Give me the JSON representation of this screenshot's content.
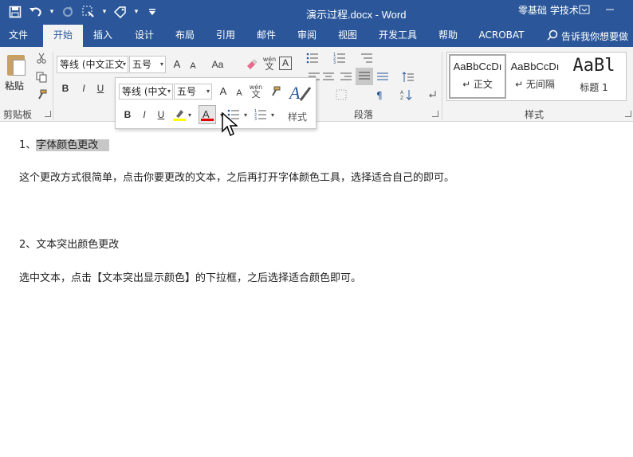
{
  "window": {
    "title": "演示过程.docx  -  Word",
    "user": "零基础 学技术",
    "controls": {
      "restore": "⧉",
      "minimize": "—"
    }
  },
  "qat": {
    "save_icon": "save-icon",
    "undo_icon": "undo-icon",
    "redo_icon": "redo-icon",
    "more": "▾"
  },
  "tabs": [
    {
      "label": "文件"
    },
    {
      "label": "开始",
      "active": true
    },
    {
      "label": "插入"
    },
    {
      "label": "设计"
    },
    {
      "label": "布局"
    },
    {
      "label": "引用"
    },
    {
      "label": "邮件"
    },
    {
      "label": "审阅"
    },
    {
      "label": "视图"
    },
    {
      "label": "开发工具"
    },
    {
      "label": "帮助"
    },
    {
      "label": "ACROBAT"
    }
  ],
  "tell_me": {
    "placeholder": "告诉我你想要做"
  },
  "ribbon": {
    "clipboard": {
      "paste_label": "粘贴",
      "group_label": "剪贴板"
    },
    "font": {
      "font_name": "等线 (中文正文",
      "font_size": "五号",
      "bold": "B",
      "italic": "I",
      "underline": "U",
      "grow": "A",
      "shrink": "A",
      "case": "Aa",
      "phonetic_top": "wén",
      "phonetic_bottom": "文",
      "border_char": "A"
    },
    "paragraph": {
      "group_label": "段落"
    },
    "styles": {
      "group_label": "样式",
      "items": [
        {
          "sample": "AaBbCcDı",
          "name": "↵ 正文"
        },
        {
          "sample": "AaBbCcDı",
          "name": "↵ 无间隔"
        },
        {
          "sample": "AaBl",
          "name": "标题 1"
        }
      ]
    }
  },
  "mini_toolbar": {
    "font_name": "等线 (中文",
    "font_size": "五号",
    "bold": "B",
    "italic": "I",
    "underline": "U",
    "styles_label": "样式",
    "font_color": "#e00000",
    "highlight_color": "#ffff00"
  },
  "document": {
    "lines": [
      {
        "number": "1、",
        "text": "字体颜色更改"
      },
      {
        "text": "这个更改方式很简单，点击你要更改的文本，之后再打开字体颜色工具，选择适合自己的即可。"
      },
      {
        "text": "2、文本突出颜色更改"
      },
      {
        "text": "选中文本，点击【文本突出显示颜色】的下拉框，之后选择适合颜色即可。"
      }
    ]
  },
  "colors": {
    "accent": "#2b579a",
    "ribbon_bg": "#f3f3f3",
    "selection": "#c7c7c7"
  }
}
